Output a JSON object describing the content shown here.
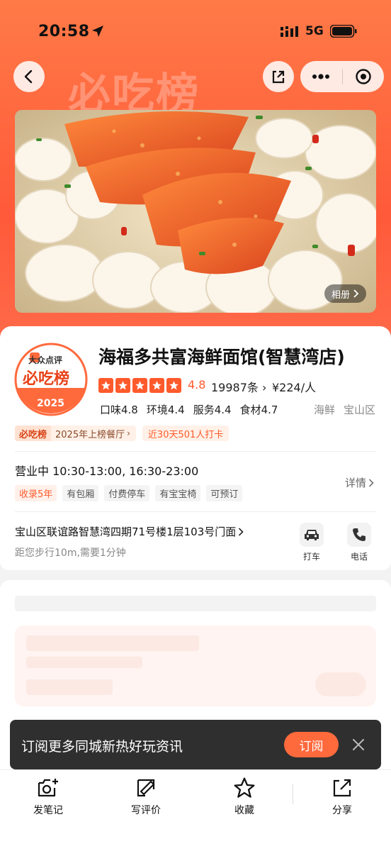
{
  "status_bar": {
    "time": "20:58",
    "network": "5G"
  },
  "hero": {
    "watermark": "必吃榜",
    "album_label": "相册"
  },
  "shop": {
    "badge_brand": "大众点评",
    "badge_title": "必吃榜",
    "badge_year": "2025",
    "name": "海福多共富海鲜面馆(智慧湾店)",
    "rating": {
      "stars": 5,
      "score": "4.8"
    },
    "reviews": "19987条",
    "price": "¥224/人",
    "sub_scores": [
      "口味4.8",
      "环境4.4",
      "服务4.4",
      "食材4.7"
    ],
    "category": "海鲜",
    "district": "宝山区",
    "rank_logo": "必吃榜",
    "rank_text": "2025年上榜餐厅",
    "checkin": "近30天501人打卡",
    "hours": "营业中  10:30-13:00, 16:30-23:00",
    "features": [
      "收录5年",
      "有包厢",
      "付费停车",
      "有宝宝椅",
      "可预订"
    ],
    "detail_label": "详情",
    "address": "宝山区联谊路智慧湾四期71号楼1层103号门面",
    "distance": "距您步行10m,需要1分钟",
    "taxi_label": "打车",
    "phone_label": "电话"
  },
  "toast": {
    "text": "订阅更多同城新热好玩资讯",
    "button": "订阅"
  },
  "bottom_bar": {
    "note": "发笔记",
    "review": "写评价",
    "favorite": "收藏",
    "share": "分享"
  },
  "colors": {
    "accent": "#ff5a2c",
    "hero_gradient_top": "#ff7a47",
    "toast_bg": "#2f2f2f"
  }
}
